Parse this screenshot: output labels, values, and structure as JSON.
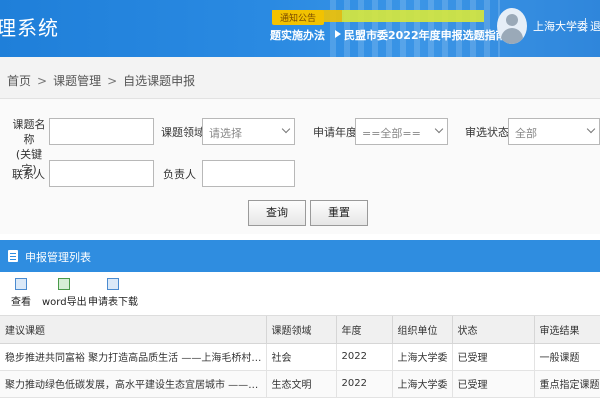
{
  "header": {
    "app_title": "理系统",
    "notice_tag": "通知公告",
    "notice_item_1": "题实施办法",
    "notice_item_2": "民盟市委2022年度申报选题指南",
    "user_name": "上海大学委",
    "logout_label": "退出"
  },
  "breadcrumb": {
    "home": "首页",
    "section": "课题管理",
    "current": "自选课题申报",
    "separator": ">"
  },
  "search": {
    "topic_label": "课题名称\n(关键字)",
    "topic_value": "",
    "field_label": "课题领域",
    "field_placeholder": "请选择",
    "year_label": "申请年度",
    "year_value": "==全部==",
    "status_label": "审选状态",
    "status_value": "全部",
    "contact_label": "联系人",
    "contact_value": "",
    "owner_label": "负责人",
    "owner_value": "",
    "query_button": "查询",
    "reset_button": "重置"
  },
  "panel": {
    "title": "申报管理列表",
    "tools": [
      "查看",
      "word导出",
      "申请表下载"
    ]
  },
  "table": {
    "columns": [
      "建议课题",
      "课题领域",
      "年度",
      "组织单位",
      "状态",
      "审选结果"
    ],
    "rows": [
      [
        "稳步推进共同富裕 聚力打造高品质生活 ——上海毛桥村精神生活共同富裕...",
        "社会",
        "2022",
        "上海大学委",
        "已受理",
        "一般课题"
      ],
      [
        "聚力推动绿色低碳发展，高水平建设生态宜居城市 ——上海城市公民生态...",
        "生态文明",
        "2022",
        "上海大学委",
        "已受理",
        "重点指定课题"
      ]
    ]
  },
  "colors": {
    "header_blue": "#2a8ae2",
    "panel_blue": "#2f8de0",
    "notice_yellow": "#f2c200"
  }
}
